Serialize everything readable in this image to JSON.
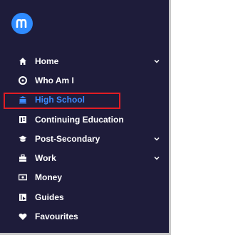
{
  "sidebar": {
    "logo_letter": "m",
    "items": [
      {
        "label": "Home",
        "icon": "home-icon",
        "has_chevron": true,
        "active": false
      },
      {
        "label": "Who Am I",
        "icon": "user-circle-icon",
        "has_chevron": false,
        "active": false
      },
      {
        "label": "High School",
        "icon": "school-icon",
        "has_chevron": false,
        "active": true
      },
      {
        "label": "Continuing Education",
        "icon": "book-icon",
        "has_chevron": false,
        "active": false
      },
      {
        "label": "Post-Secondary",
        "icon": "graduation-cap-icon",
        "has_chevron": true,
        "active": false
      },
      {
        "label": "Work",
        "icon": "briefcase-icon",
        "has_chevron": true,
        "active": false
      },
      {
        "label": "Money",
        "icon": "money-icon",
        "has_chevron": false,
        "active": false
      },
      {
        "label": "Guides",
        "icon": "guides-icon",
        "has_chevron": false,
        "active": false
      },
      {
        "label": "Favourites",
        "icon": "heart-icon",
        "has_chevron": false,
        "active": false
      }
    ]
  },
  "colors": {
    "sidebar_bg": "#1e1c3a",
    "text": "#ffffff",
    "active_text": "#3d8bff",
    "logo_bg": "#2f8bff",
    "highlight_border": "#e11d24"
  }
}
